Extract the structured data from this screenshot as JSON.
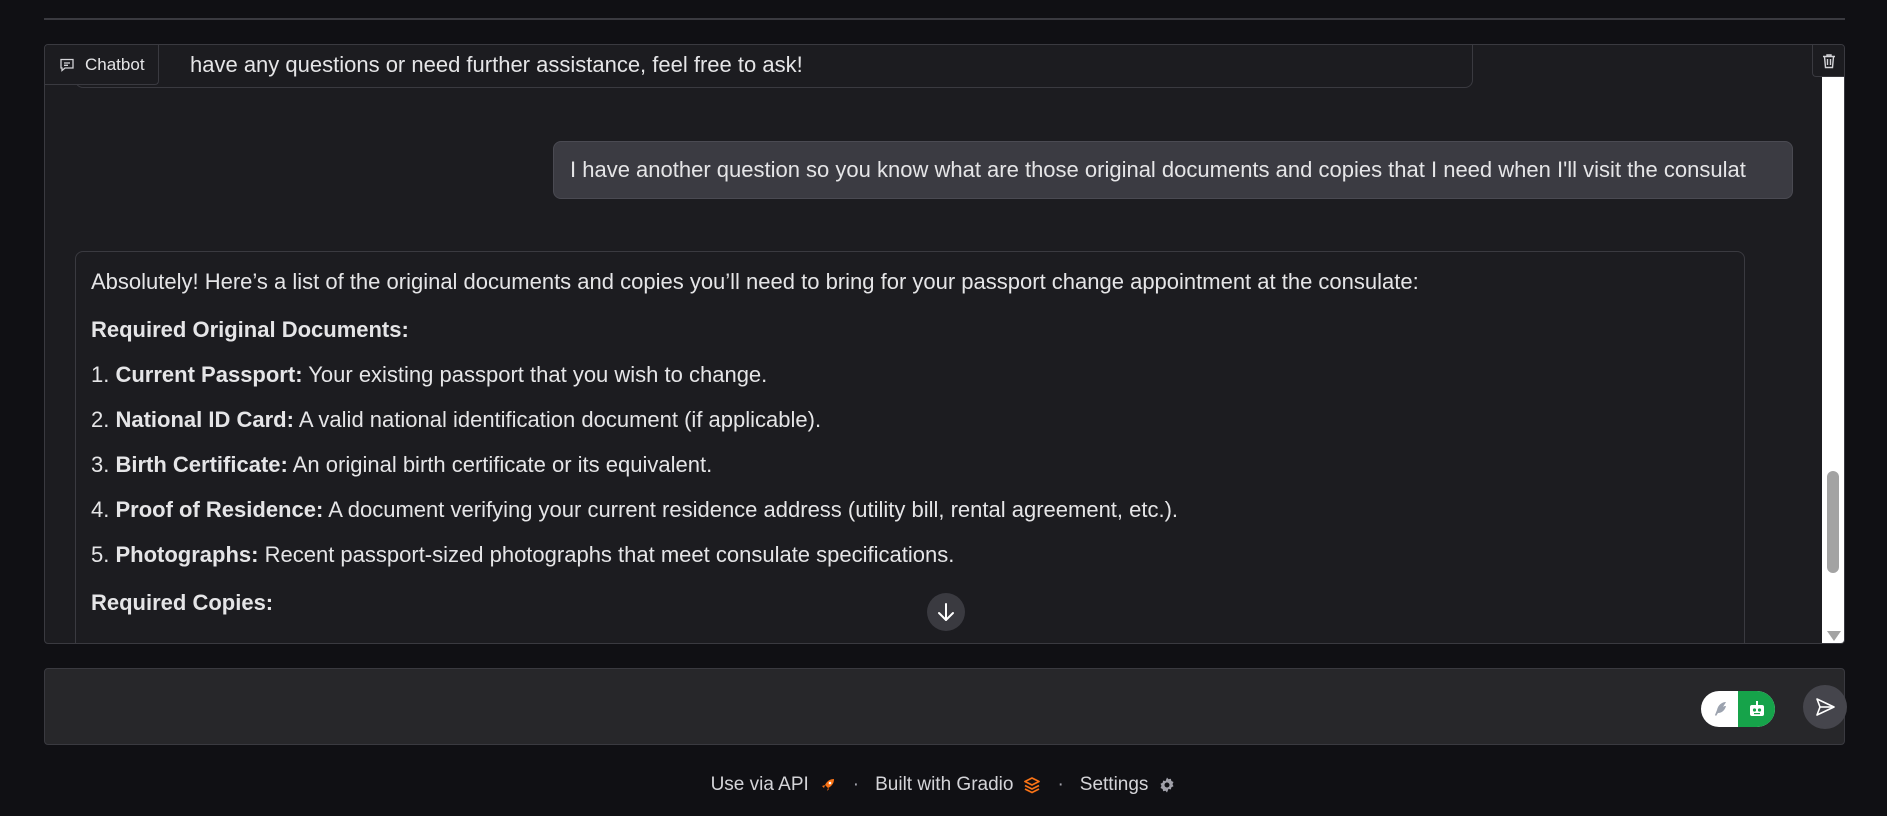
{
  "chatbot": {
    "label": "Chatbot",
    "prev_message_tail": "have any questions or need further assistance, feel free to ask!",
    "user_message": "I have another question so you know what are those original documents and copies that I need when I'll visit the consulat",
    "bot_message": {
      "intro": "Absolutely! Here’s a list of the original documents and copies you’ll need to bring for your passport change appointment at the consulate:",
      "section1_heading": "Required Original Documents:",
      "items": [
        {
          "num": "1.",
          "title": "Current Passport:",
          "text": "Your existing passport that you wish to change."
        },
        {
          "num": "2.",
          "title": "National ID Card:",
          "text": "A valid national identification document (if applicable)."
        },
        {
          "num": "3.",
          "title": "Birth Certificate:",
          "text": "An original birth certificate or its equivalent."
        },
        {
          "num": "4.",
          "title": "Proof of Residence:",
          "text": "A document verifying your current residence address (utility bill, rental agreement, etc.)."
        },
        {
          "num": "5.",
          "title": "Photographs:",
          "text": "Recent passport-sized photographs that meet consulate specifications."
        }
      ],
      "section2_heading": "Required Copies:"
    }
  },
  "input": {
    "placeholder": ""
  },
  "footer": {
    "api_label": "Use via API",
    "built_label": "Built with Gradio",
    "settings_label": "Settings",
    "separator": "·"
  },
  "colors": {
    "background": "#101014",
    "panel": "#1c1c20",
    "user_bubble": "#3b3b42",
    "toggle_green": "#16a34a",
    "gradio_orange": "#f97316"
  }
}
